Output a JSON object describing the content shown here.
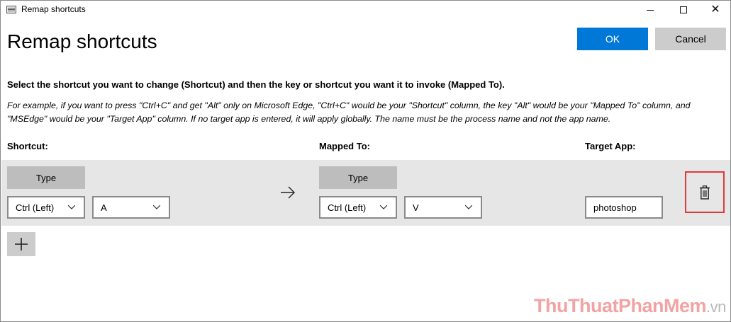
{
  "window": {
    "title": "Remap shortcuts",
    "minimize_icon": "minimize-icon",
    "maximize_icon": "maximize-icon",
    "close_icon": "close-icon"
  },
  "header": {
    "heading": "Remap shortcuts",
    "ok_label": "OK",
    "cancel_label": "Cancel"
  },
  "instructions": "Select the shortcut you want to change (Shortcut) and then the key or shortcut you want it to invoke (Mapped To).",
  "example": "For example, if you want to press \"Ctrl+C\" and get \"Alt\" only on Microsoft Edge, \"Ctrl+C\" would be your \"Shortcut\" column, the key \"Alt\" would be your \"Mapped To\" column, and \"MSEdge\" would be your \"Target App\" column. If no target app is entered, it will apply globally. The name must be the process name and not the app name.",
  "columns": {
    "shortcut": "Shortcut:",
    "mapped_to": "Mapped To:",
    "target_app": "Target App:"
  },
  "row": {
    "shortcut_type_label": "Type",
    "shortcut_modifier": "Ctrl (Left)",
    "shortcut_key": "A",
    "mapped_type_label": "Type",
    "mapped_modifier": "Ctrl (Left)",
    "mapped_key": "V",
    "target_app_value": "photoshop",
    "delete_icon": "trash-icon",
    "arrow_icon": "arrow-right-icon"
  },
  "add_icon": "plus-icon",
  "watermark": {
    "part1": "ThuThuat",
    "part2": "PhanMem",
    "part3": ".vn"
  },
  "colors": {
    "accent": "#0078d7",
    "highlight_border": "#e03a3a",
    "row_background": "#e6e6e6"
  }
}
